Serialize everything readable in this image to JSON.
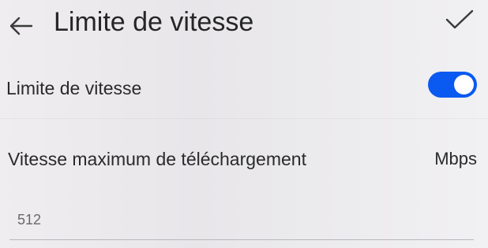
{
  "header": {
    "title": "Limite de vitesse",
    "back_icon": "arrow-left-icon",
    "confirm_icon": "checkmark-icon"
  },
  "speed_limit_toggle": {
    "label": "Limite de vitesse",
    "enabled": true,
    "accent_color": "#0A59F0"
  },
  "max_download": {
    "label": "Vitesse maximum de téléchargement",
    "unit": "Mbps",
    "value": "512"
  }
}
